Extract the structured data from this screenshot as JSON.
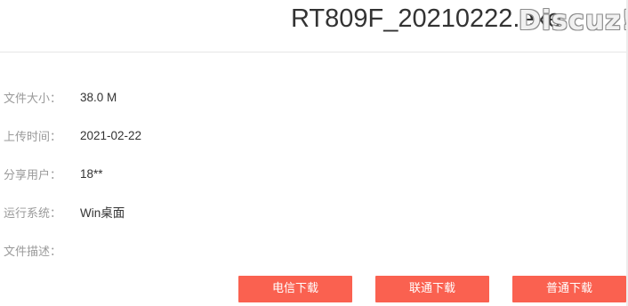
{
  "header": {
    "file_title": "RT809F_20210222.exe",
    "watermark": "Discuz!"
  },
  "details": [
    {
      "label": "文件大小：",
      "value": "38.0 M"
    },
    {
      "label": "上传时间：",
      "value": "2021-02-22"
    },
    {
      "label": "分享用户：",
      "value": "18**"
    },
    {
      "label": "运行系统：",
      "value": "Win桌面"
    },
    {
      "label": "文件描述：",
      "value": ""
    }
  ],
  "buttons": {
    "telecom": "电信下载",
    "unicom": "联通下载",
    "normal": "普通下载"
  },
  "colors": {
    "button_bg": "#fa6150",
    "label_text": "#9a9a9a",
    "value_text": "#333333"
  }
}
